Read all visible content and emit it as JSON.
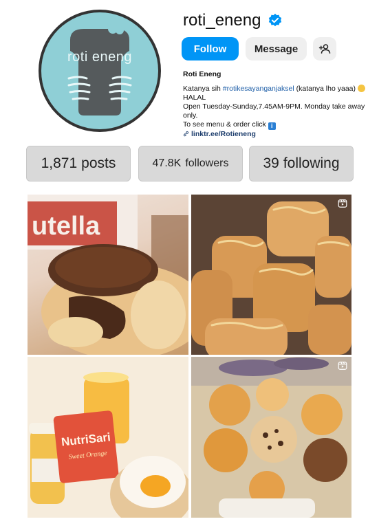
{
  "profile": {
    "avatar_text": "roti eneng",
    "username": "roti_eneng",
    "verified": true,
    "follow_label": "Follow",
    "message_label": "Message",
    "display_name": "Roti Eneng",
    "bio_line1_prefix": "Katanya sih ",
    "bio_hashtag": "#rotikesayanganjaksel",
    "bio_line1_suffix": " (katanya lho yaaa)",
    "bio_line2": "HALAL",
    "bio_line3": "Open Tuesday-Sunday,7.45AM-9PM. Monday take away only.",
    "bio_line4": "To see menu & order click ",
    "link": "linktr.ee/Rotieneng"
  },
  "stats": {
    "posts_count": "1,871",
    "posts_label": "posts",
    "followers_count": "47.8K",
    "followers_label": "followers",
    "following_count": "39",
    "following_label": "following"
  },
  "grid": {
    "posts": [
      {
        "subject": "nutella-bread",
        "label_text": "utella"
      },
      {
        "subject": "cheese-bread-loaves",
        "is_reel": true
      },
      {
        "subject": "nutrisari-juice-and-bun",
        "label_text": "NutriSari",
        "sub_label": "Sweet Orange"
      },
      {
        "subject": "assorted-breads-basket",
        "is_reel": true
      }
    ]
  },
  "colors": {
    "accent_blue": "#0095f6",
    "avatar_bg": "#8fcfd6",
    "stat_bg": "#d9d9d9"
  },
  "icons": {
    "verified": "verified-badge-icon",
    "add_user": "add-user-icon",
    "link": "link-icon",
    "reel": "reel-icon"
  }
}
